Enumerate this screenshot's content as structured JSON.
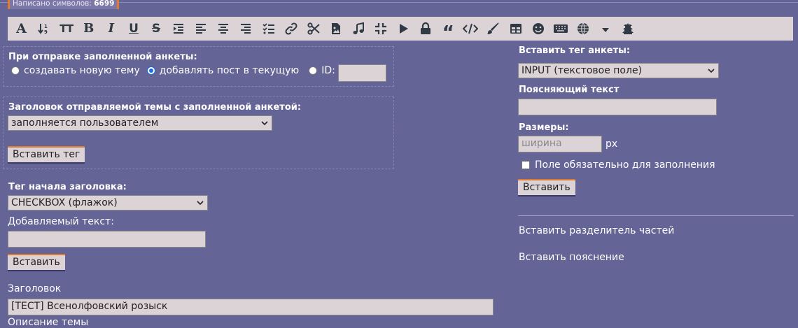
{
  "counter": {
    "label": "Написано символов:",
    "value": "6699"
  },
  "toolbar": {
    "items": [
      {
        "name": "font-icon",
        "glyph": "A"
      },
      {
        "name": "sort-icon",
        "glyph": "sort"
      },
      {
        "name": "text-size-icon",
        "glyph": "TT"
      },
      {
        "name": "bold-icon",
        "glyph": "B"
      },
      {
        "name": "italic-icon",
        "glyph": "I"
      },
      {
        "name": "underline-icon",
        "glyph": "U"
      },
      {
        "name": "strikethrough-icon",
        "glyph": "S"
      },
      {
        "name": "indent-icon",
        "glyph": "indent"
      },
      {
        "name": "align-left-icon",
        "glyph": "align-left"
      },
      {
        "name": "align-center-icon",
        "glyph": "align-center"
      },
      {
        "name": "align-right-icon",
        "glyph": "align-right"
      },
      {
        "name": "checklist-icon",
        "glyph": "checklist"
      },
      {
        "name": "link-icon",
        "glyph": "link"
      },
      {
        "name": "scissors-icon",
        "glyph": "scissors"
      },
      {
        "name": "file-image-icon",
        "glyph": "file"
      },
      {
        "name": "music-icon",
        "glyph": "music"
      },
      {
        "name": "compress-icon",
        "glyph": "compress"
      },
      {
        "name": "play-icon",
        "glyph": "play"
      },
      {
        "name": "lock-icon",
        "glyph": "lock"
      },
      {
        "name": "quote-icon",
        "glyph": "quote"
      },
      {
        "name": "code-icon",
        "glyph": "code"
      },
      {
        "name": "brush-icon",
        "glyph": "brush"
      },
      {
        "name": "table-icon",
        "glyph": "table"
      },
      {
        "name": "smile-icon",
        "glyph": "smile"
      },
      {
        "name": "keyboard-icon",
        "glyph": "keyboard"
      },
      {
        "name": "globe-icon",
        "glyph": "globe"
      },
      {
        "name": "caret-down-icon",
        "glyph": "caret"
      },
      {
        "name": "pagoda-icon",
        "glyph": "pagoda"
      }
    ]
  },
  "send": {
    "heading": "При отправке заполненной анкеты:",
    "opt_new": "создавать новую тему",
    "opt_add": "добавлять пост в текущую",
    "opt_id": "ID:",
    "id_value": ""
  },
  "topic_title": {
    "heading": "Заголовок отправляемой темы с заполненной анкетой:",
    "select_value": "заполняется пользователем",
    "insert_button": "Вставить тег"
  },
  "header_tag": {
    "heading": "Тег начала заголовка:",
    "select_value": "CHECKBOX (флажок)",
    "added_text_label": "Добавляемый текст:",
    "added_text_value": "",
    "insert_button": "Вставить"
  },
  "title": {
    "label": "Заголовок",
    "value": "[ТЕСТ] Всенолфовский розыск"
  },
  "description": {
    "label": "Описание темы"
  },
  "form_tag": {
    "heading": "Вставить тег анкеты:",
    "select_value": "INPUT (текстовое поле)",
    "hint_label": "Поясняющий текст",
    "hint_value": "",
    "sizes_label": "Размеры:",
    "width_placeholder": "ширина",
    "unit": "px",
    "required_label": "Поле обязательно для заполнения",
    "insert_button": "Вставить"
  },
  "links": {
    "separator": "Вставить разделитель частей",
    "explanation": "Вставить пояснение"
  },
  "colors": {
    "background": "#646496",
    "field": "#dcd3d6",
    "accent": "#e07a2c"
  }
}
